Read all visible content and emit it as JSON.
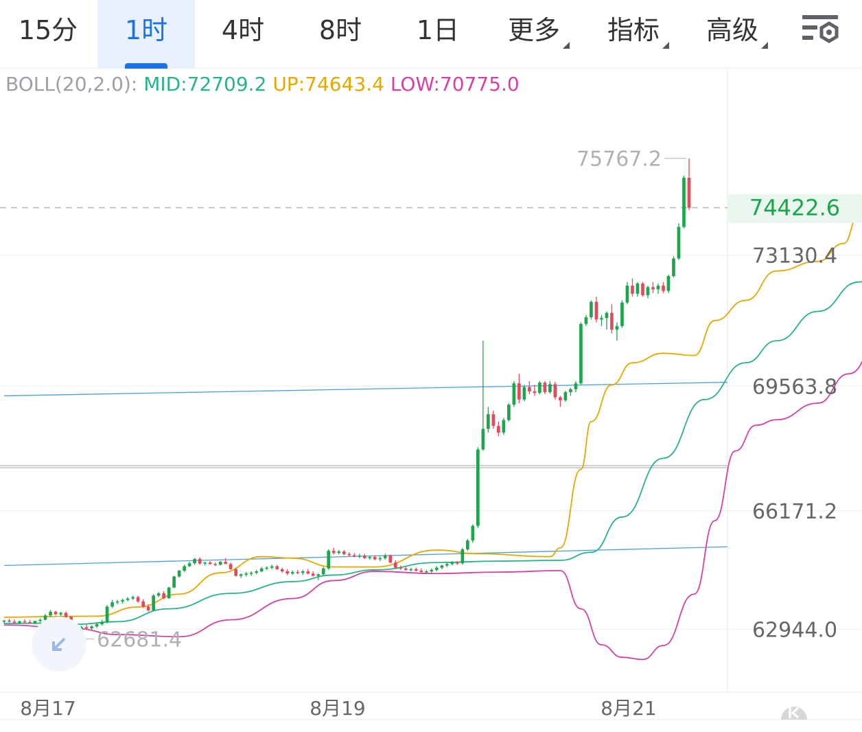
{
  "toolbar": {
    "tabs": [
      {
        "label": "15分",
        "active": false
      },
      {
        "label": "1时",
        "active": true
      },
      {
        "label": "4时",
        "active": false
      },
      {
        "label": "8时",
        "active": false
      },
      {
        "label": "1日",
        "active": false
      },
      {
        "label": "更多",
        "active": false,
        "dropdown": true
      },
      {
        "label": "指标",
        "active": false,
        "dropdown": true
      },
      {
        "label": "高级",
        "active": false,
        "dropdown": true
      }
    ],
    "settings_icon": "chart-settings-icon"
  },
  "indicator": {
    "name": "BOLL(20,2.0):",
    "mid_label": "MID:72709.2",
    "up_label": "UP:74643.4",
    "low_label": "LOW:70775.0",
    "colors": {
      "mid": "#26b38a",
      "up": "#e6a700",
      "low": "#d63fa5"
    }
  },
  "chart_data": {
    "type": "candlestick",
    "y_axis": {
      "ticks": [
        "73130.4",
        "69563.8",
        "66171.2",
        "62944.0"
      ],
      "tick_values": [
        73130.4,
        69563.8,
        66171.2,
        62944.0
      ],
      "range": [
        61230,
        78210
      ]
    },
    "x_axis": {
      "ticks": [
        "8月17",
        "8月19",
        "8月21"
      ]
    },
    "current_price": {
      "label": "74422.6",
      "value": 74422.6
    },
    "high_label": {
      "text": "75767.2",
      "value": 75767.2
    },
    "low_label": {
      "text": "62681.4",
      "value": 62681.4
    },
    "colors": {
      "up": "#1aa64a",
      "down": "#e04a5a",
      "price_label": "#1aa64a",
      "trend_line": "#4a9fd8"
    },
    "trend_lines": [
      {
        "from": [
          0,
          69300
        ],
        "to": [
          137,
          69670
        ]
      },
      {
        "from": [
          0,
          64680
        ],
        "to": [
          137,
          65190
        ]
      }
    ],
    "horizontal_line": 67400,
    "candles": [
      [
        63150,
        63200,
        63100,
        63180
      ],
      [
        63180,
        63230,
        63120,
        63150
      ],
      [
        63150,
        63210,
        63100,
        63120
      ],
      [
        63120,
        63180,
        63080,
        63160
      ],
      [
        63160,
        63220,
        63120,
        63140
      ],
      [
        63140,
        63200,
        63090,
        63110
      ],
      [
        63110,
        63180,
        63080,
        63170
      ],
      [
        63170,
        63240,
        63130,
        63200
      ],
      [
        63200,
        63360,
        63170,
        63320
      ],
      [
        63320,
        63470,
        63280,
        63420
      ],
      [
        63420,
        63450,
        63330,
        63350
      ],
      [
        63350,
        63420,
        63300,
        63390
      ],
      [
        63390,
        63430,
        63250,
        63280
      ],
      [
        63280,
        63310,
        63020,
        63060
      ],
      [
        63060,
        63100,
        62890,
        62950
      ],
      [
        62950,
        63040,
        62890,
        63000
      ],
      [
        63000,
        63080,
        62940,
        62970
      ],
      [
        62970,
        63050,
        62920,
        63020
      ],
      [
        63020,
        63120,
        62980,
        63080
      ],
      [
        63080,
        63200,
        63040,
        63140
      ],
      [
        63140,
        63600,
        63100,
        63560
      ],
      [
        63560,
        63740,
        63520,
        63680
      ],
      [
        63680,
        63740,
        63620,
        63700
      ],
      [
        63700,
        63780,
        63640,
        63740
      ],
      [
        63740,
        63820,
        63700,
        63780
      ],
      [
        63780,
        63860,
        63740,
        63820
      ],
      [
        63820,
        63860,
        63660,
        63700
      ],
      [
        63700,
        63760,
        63520,
        63560
      ],
      [
        63560,
        63620,
        63420,
        63460
      ],
      [
        63460,
        63900,
        63440,
        63860
      ],
      [
        63860,
        63960,
        63820,
        63920
      ],
      [
        63920,
        63980,
        63760,
        63790
      ],
      [
        63790,
        64100,
        63770,
        64080
      ],
      [
        64080,
        64400,
        64060,
        64380
      ],
      [
        64380,
        64560,
        64350,
        64540
      ],
      [
        64540,
        64700,
        64500,
        64660
      ],
      [
        64660,
        64780,
        64640,
        64740
      ],
      [
        64740,
        64880,
        64700,
        64860
      ],
      [
        64860,
        64900,
        64700,
        64730
      ],
      [
        64730,
        64780,
        64680,
        64760
      ],
      [
        64760,
        64800,
        64700,
        64720
      ],
      [
        64720,
        64760,
        64660,
        64700
      ],
      [
        64700,
        64800,
        64680,
        64780
      ],
      [
        64780,
        64880,
        64740,
        64720
      ],
      [
        64720,
        64760,
        64560,
        64580
      ],
      [
        64580,
        64620,
        64380,
        64400
      ],
      [
        64400,
        64460,
        64340,
        64440
      ],
      [
        64440,
        64500,
        64380,
        64460
      ],
      [
        64460,
        64520,
        64400,
        64480
      ],
      [
        64480,
        64560,
        64440,
        64520
      ],
      [
        64520,
        64640,
        64500,
        64600
      ],
      [
        64600,
        64660,
        64560,
        64620
      ],
      [
        64620,
        64700,
        64580,
        64660
      ],
      [
        64660,
        64700,
        64560,
        64580
      ],
      [
        64580,
        64620,
        64480,
        64520
      ],
      [
        64520,
        64580,
        64420,
        64460
      ],
      [
        64460,
        64540,
        64420,
        64500
      ],
      [
        64500,
        64560,
        64440,
        64480
      ],
      [
        64480,
        64560,
        64420,
        64520
      ],
      [
        64520,
        64580,
        64440,
        64460
      ],
      [
        64460,
        64520,
        64380,
        64400
      ],
      [
        64400,
        64460,
        64280,
        64440
      ],
      [
        64440,
        64640,
        64400,
        64600
      ],
      [
        64600,
        65120,
        64560,
        65080
      ],
      [
        65080,
        65160,
        64980,
        65020
      ],
      [
        65020,
        65100,
        64980,
        65060
      ],
      [
        65060,
        65100,
        64960,
        64990
      ],
      [
        64990,
        65040,
        64920,
        64960
      ],
      [
        64960,
        65020,
        64900,
        64930
      ],
      [
        64930,
        65000,
        64880,
        64950
      ],
      [
        64950,
        65000,
        64860,
        64880
      ],
      [
        64880,
        64940,
        64840,
        64910
      ],
      [
        64910,
        64960,
        64820,
        64850
      ],
      [
        64850,
        64920,
        64800,
        64880
      ],
      [
        64880,
        65000,
        64840,
        64960
      ],
      [
        64960,
        64980,
        64740,
        64760
      ],
      [
        64760,
        64820,
        64600,
        64620
      ],
      [
        64620,
        64680,
        64560,
        64600
      ],
      [
        64600,
        64640,
        64540,
        64560
      ],
      [
        64560,
        64620,
        64520,
        64580
      ],
      [
        64580,
        64620,
        64520,
        64540
      ],
      [
        64540,
        64600,
        64480,
        64500
      ],
      [
        64500,
        64560,
        64440,
        64520
      ],
      [
        64520,
        64600,
        64480,
        64560
      ],
      [
        64560,
        64660,
        64520,
        64620
      ],
      [
        64620,
        64700,
        64580,
        64680
      ],
      [
        64680,
        64760,
        64640,
        64720
      ],
      [
        64720,
        64800,
        64680,
        64760
      ],
      [
        64760,
        64800,
        64700,
        64740
      ],
      [
        64740,
        65160,
        64700,
        65120
      ],
      [
        65120,
        65400,
        65080,
        65360
      ],
      [
        65360,
        65800,
        65300,
        65760
      ],
      [
        65760,
        67900,
        65700,
        67840
      ],
      [
        67840,
        70800,
        67800,
        68400
      ],
      [
        68400,
        69000,
        68300,
        68800
      ],
      [
        68800,
        68900,
        68400,
        68480
      ],
      [
        68480,
        68600,
        68200,
        68300
      ],
      [
        68300,
        68700,
        68240,
        68640
      ],
      [
        68640,
        69100,
        68600,
        69060
      ],
      [
        69060,
        69700,
        69000,
        69640
      ],
      [
        69640,
        69900,
        69100,
        69200
      ],
      [
        69200,
        69600,
        69150,
        69540
      ],
      [
        69540,
        69700,
        69350,
        69420
      ],
      [
        69420,
        69600,
        69300,
        69380
      ],
      [
        69380,
        69700,
        69340,
        69660
      ],
      [
        69660,
        69700,
        69350,
        69400
      ],
      [
        69400,
        69700,
        69360,
        69620
      ],
      [
        69620,
        69680,
        69200,
        69260
      ],
      [
        69260,
        69300,
        69000,
        69180
      ],
      [
        69180,
        69440,
        69140,
        69400
      ],
      [
        69400,
        69520,
        69300,
        69480
      ],
      [
        69480,
        69700,
        69400,
        69640
      ],
      [
        69640,
        71300,
        69600,
        71260
      ],
      [
        71260,
        71500,
        71200,
        71440
      ],
      [
        71440,
        71900,
        71380,
        71860
      ],
      [
        71860,
        72000,
        71300,
        71380
      ],
      [
        71380,
        71500,
        71200,
        71420
      ],
      [
        71420,
        71600,
        71100,
        71560
      ],
      [
        71560,
        71800,
        71000,
        71100
      ],
      [
        71100,
        71300,
        70800,
        71200
      ],
      [
        71200,
        71900,
        71150,
        71840
      ],
      [
        71840,
        72400,
        71800,
        72300
      ],
      [
        72300,
        72500,
        72000,
        72080
      ],
      [
        72080,
        72400,
        72000,
        72360
      ],
      [
        72360,
        72400,
        72000,
        72040
      ],
      [
        72040,
        72300,
        71960,
        72260
      ],
      [
        72260,
        72400,
        72100,
        72200
      ],
      [
        72200,
        72360,
        72080,
        72300
      ],
      [
        72300,
        72400,
        72100,
        72160
      ],
      [
        72160,
        72600,
        72100,
        72560
      ],
      [
        72560,
        73100,
        72520,
        73040
      ],
      [
        73040,
        74000,
        73000,
        73900
      ],
      [
        73900,
        75300,
        73860,
        75240
      ],
      [
        75240,
        75767,
        74360,
        74422
      ]
    ],
    "bollinger": {
      "up": [
        [
          0,
          63270
        ],
        [
          10,
          63290
        ],
        [
          18,
          63300
        ],
        [
          26,
          63550
        ],
        [
          34,
          63900
        ],
        [
          42,
          64480
        ],
        [
          50,
          64920
        ],
        [
          56,
          64880
        ],
        [
          64,
          64640
        ],
        [
          72,
          64640
        ],
        [
          84,
          65100
        ],
        [
          92,
          65000
        ],
        [
          106,
          64920
        ],
        [
          108,
          65160
        ],
        [
          112,
          67300
        ],
        [
          114,
          68600
        ],
        [
          118,
          69600
        ],
        [
          122,
          70200
        ],
        [
          128,
          70460
        ],
        [
          134,
          70400
        ],
        [
          138,
          71350
        ],
        [
          144,
          71900
        ],
        [
          150,
          72700
        ],
        [
          158,
          72960
        ],
        [
          163,
          73450
        ],
        [
          166,
          74240
        ],
        [
          170,
          74643
        ]
      ],
      "mid": [
        [
          0,
          63100
        ],
        [
          8,
          63110
        ],
        [
          14,
          63080
        ],
        [
          22,
          63150
        ],
        [
          32,
          63500
        ],
        [
          44,
          63920
        ],
        [
          56,
          64240
        ],
        [
          64,
          64420
        ],
        [
          72,
          64560
        ],
        [
          84,
          64760
        ],
        [
          96,
          64800
        ],
        [
          108,
          64820
        ],
        [
          114,
          65040
        ],
        [
          120,
          66000
        ],
        [
          128,
          67600
        ],
        [
          136,
          69200
        ],
        [
          144,
          70200
        ],
        [
          150,
          70800
        ],
        [
          158,
          71600
        ],
        [
          166,
          72400
        ],
        [
          170,
          72709
        ]
      ],
      "low": [
        [
          0,
          63060
        ],
        [
          14,
          62960
        ],
        [
          22,
          62800
        ],
        [
          34,
          62740
        ],
        [
          44,
          63200
        ],
        [
          56,
          63780
        ],
        [
          64,
          64270
        ],
        [
          72,
          64520
        ],
        [
          84,
          64460
        ],
        [
          96,
          64500
        ],
        [
          108,
          64540
        ],
        [
          112,
          63500
        ],
        [
          116,
          62520
        ],
        [
          120,
          62180
        ],
        [
          124,
          62120
        ],
        [
          128,
          62500
        ],
        [
          134,
          63900
        ],
        [
          138,
          65900
        ],
        [
          142,
          67800
        ],
        [
          146,
          68500
        ],
        [
          150,
          68650
        ],
        [
          158,
          69100
        ],
        [
          164,
          69900
        ],
        [
          170,
          70775
        ]
      ]
    }
  }
}
